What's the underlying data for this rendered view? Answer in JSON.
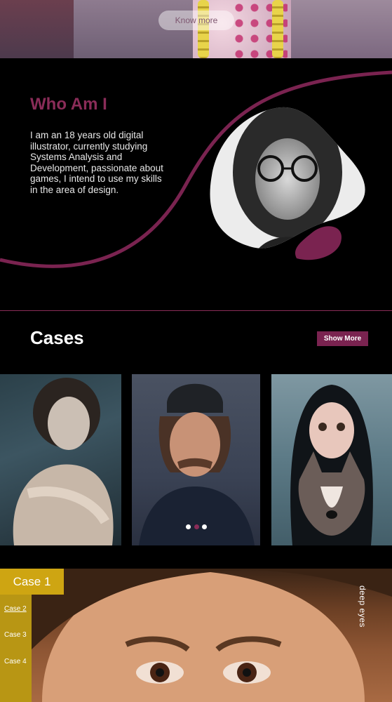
{
  "hero": {
    "know_more_label": "Know more"
  },
  "about": {
    "title": "Who Am I",
    "text": "I am an 18 years old digital illustrator, currently studying Systems Analysis and Development, passionate about games, I intend to use my skills in the area of design."
  },
  "cases": {
    "title": "Cases",
    "show_more_label": "Show More",
    "carousel_active_index": 2,
    "carousel_count": 3
  },
  "feature": {
    "active_case": "Case 1",
    "cases": [
      "Case 2",
      "Case 3",
      "Case 4"
    ],
    "caption": "deep eyes"
  },
  "colors": {
    "accent": "#8a2c58",
    "gold": "#cea512",
    "background": "#000000"
  }
}
